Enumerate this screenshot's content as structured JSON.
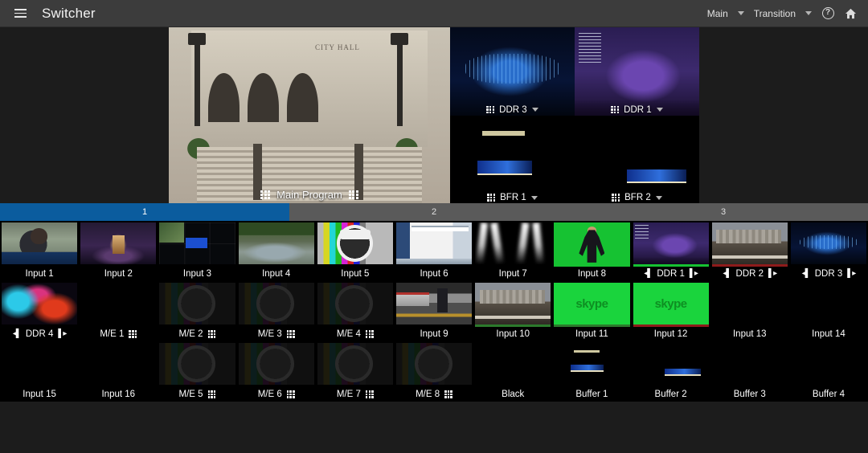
{
  "titlebar": {
    "menu_icon": "hamburger-icon",
    "title": "Switcher",
    "bus_select": {
      "label": "Main",
      "caret": "chevron-down-icon"
    },
    "transition_select": {
      "label": "Transition",
      "caret": "chevron-down-icon"
    },
    "help_icon": "help-icon",
    "help_glyph": "?",
    "home_icon": "home-icon"
  },
  "monitors": {
    "program": {
      "label": "Main Program",
      "left_icon": "grid-icon",
      "right_icon": "grid-dots-icon",
      "art": "cityhall",
      "sign_text": "CITY HALL"
    },
    "cells": [
      {
        "label": "DDR 3",
        "art": "bluetech",
        "icon": "grid-icon",
        "caret": "chevron-down-icon"
      },
      {
        "label": "DDR 1",
        "art": "game",
        "icon": "grid-icon",
        "caret": "chevron-down-icon"
      },
      {
        "label": "BFR 1",
        "art": "lower3",
        "icon": "grid-icon",
        "caret": "chevron-down-icon"
      },
      {
        "label": "BFR 2",
        "art": "lower3b",
        "icon": "grid-icon",
        "caret": "chevron-down-icon"
      }
    ]
  },
  "tabs": {
    "active_index": 0,
    "items": [
      {
        "label": "1"
      },
      {
        "label": "2"
      },
      {
        "label": "3"
      }
    ]
  },
  "sources": {
    "rows": [
      [
        {
          "label": "Input 1",
          "art": "call",
          "state": "none"
        },
        {
          "label": "Input 2",
          "art": "studio",
          "state": "none"
        },
        {
          "label": "Input 3",
          "art": "multiview",
          "state": "none"
        },
        {
          "label": "Input 4",
          "art": "river",
          "state": "none"
        },
        {
          "label": "Input 5",
          "art": "testpat",
          "state": "preview"
        },
        {
          "label": "Input 6",
          "art": "desktop",
          "state": "none"
        },
        {
          "label": "Input 7",
          "art": "spot",
          "state": "none"
        },
        {
          "label": "Input 8",
          "art": "green",
          "state": "none",
          "strip": "#16c232"
        },
        {
          "label": "DDR 1",
          "art": "game",
          "state": "program",
          "transport": true,
          "strip": "#16c232"
        },
        {
          "label": "DDR 2",
          "art": "city",
          "state": "program",
          "transport": true,
          "strip": "#8e1b1b"
        },
        {
          "label": "DDR 3",
          "art": "bluetech",
          "state": "none",
          "transport": true
        }
      ],
      [
        {
          "label": "DDR 4",
          "art": "abstract",
          "state": "none",
          "transport": true
        },
        {
          "label": "M/E 1",
          "art": "black",
          "state": "program",
          "me": true
        },
        {
          "label": "M/E 2",
          "art": "darkpat",
          "state": "none",
          "me": true
        },
        {
          "label": "M/E 3",
          "art": "darkpat",
          "state": "none",
          "me": true
        },
        {
          "label": "M/E 4",
          "art": "darkpat",
          "state": "none",
          "me": true
        },
        {
          "label": "Input 9",
          "art": "subway",
          "state": "none"
        },
        {
          "label": "Input 10",
          "art": "city",
          "state": "none",
          "strip": "#2c7a2c"
        },
        {
          "label": "Input 11",
          "art": "skype",
          "state": "none",
          "logo": "skype",
          "strip": "#2c7a2c"
        },
        {
          "label": "Input 12",
          "art": "skype",
          "state": "none",
          "logo": "skype",
          "strip": "#8e1b1b"
        },
        {
          "label": "Input 13",
          "art": "black",
          "state": "program-dim"
        },
        {
          "label": "Input 14",
          "art": "black",
          "state": "none"
        }
      ],
      [
        {
          "label": "Input 15",
          "art": "black",
          "state": "none"
        },
        {
          "label": "Input 16",
          "art": "black",
          "state": "none"
        },
        {
          "label": "M/E 5",
          "art": "darkpat",
          "state": "none",
          "me": true
        },
        {
          "label": "M/E 6",
          "art": "darkpat",
          "state": "none",
          "me": true
        },
        {
          "label": "M/E 7",
          "art": "darkpat",
          "state": "none",
          "me": true
        },
        {
          "label": "M/E 8",
          "art": "darkpat",
          "state": "none",
          "me": true
        },
        {
          "label": "Black",
          "art": "black",
          "state": "none"
        },
        {
          "label": "Buffer 1",
          "art": "lower3",
          "state": "none"
        },
        {
          "label": "Buffer 2",
          "art": "lower3b",
          "state": "none"
        },
        {
          "label": "Buffer 3",
          "art": "black",
          "state": "none"
        },
        {
          "label": "Buffer 4",
          "art": "black",
          "state": "none"
        }
      ]
    ]
  },
  "colors": {
    "accent_blue": "#0b5c9e",
    "titlebar_bg": "#3c3c3c",
    "program_red": "#c81d1d",
    "preview_green": "#3ad13a",
    "background": "#1c1c1c"
  },
  "icons": {
    "skip_back": "◀",
    "skip_fwd": "▶"
  }
}
